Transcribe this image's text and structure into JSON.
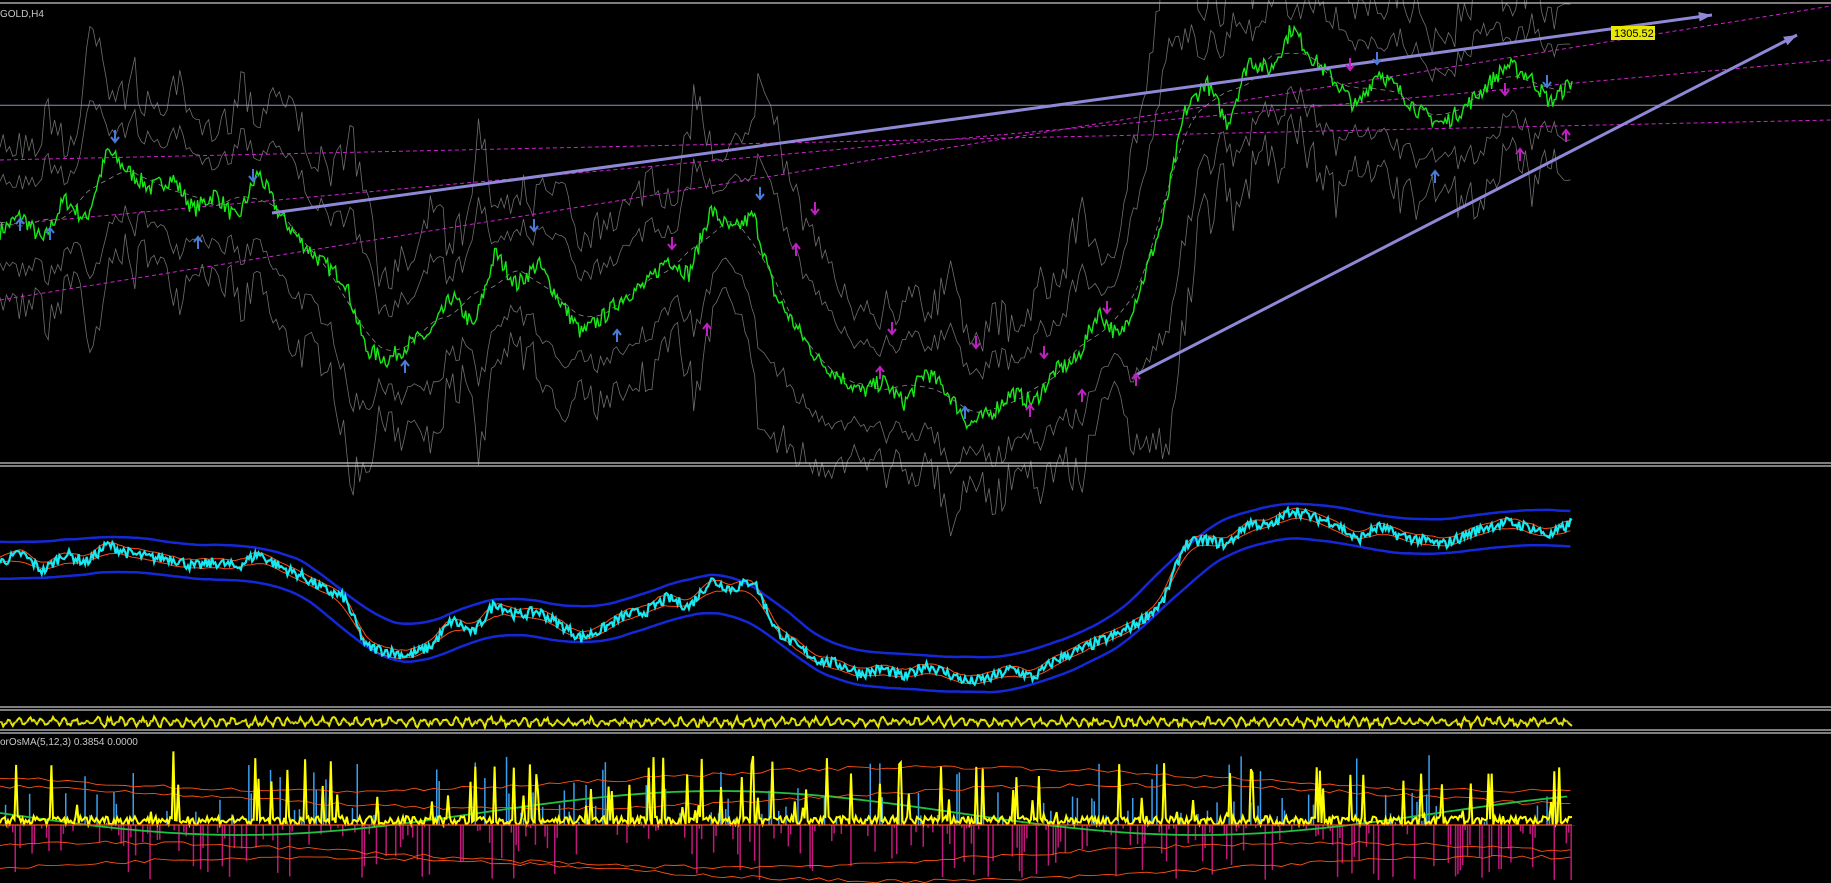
{
  "window": {
    "symbol_label": "GOLD,H4"
  },
  "colors": {
    "background": "#000000",
    "separator": "#c8c8c8",
    "price": "#18e818",
    "bands": "#8a8a8a",
    "trendline": "#8f88d6",
    "channel": "#d020d0",
    "hline": "#8a94b0",
    "arrow_blue": "#4a7bd8",
    "arrow_purple": "#c020c0",
    "price_tag_bg": "#e8e800",
    "ind1_main": "#18e8f0",
    "ind1_band": "#1428d8",
    "ind1_ma": "#ff4a10",
    "ind2_line": "#e8e800",
    "ind3_pos": "#3aa0f0",
    "ind3_neg": "#c0187a",
    "ind3_yellow": "#ffff00",
    "ind3_green": "#20c040",
    "ind3_orange": "#ff5010"
  },
  "price_tag": {
    "value": "1305.52"
  },
  "indicator_label": {
    "text": "orOsMA(5,12,3) 0.3854 0.0000"
  },
  "chart_data": [
    {
      "type": "line",
      "title": "GOLD,H4",
      "series": [
        {
          "name": "",
          "values": [
            1268,
            1271,
            1266,
            1274,
            1270,
            1283,
            1279,
            1276,
            1278,
            1272,
            1275,
            1270,
            1279,
            1271,
            1266,
            1262,
            1259,
            1246,
            1244,
            1247,
            1249,
            1256,
            1250,
            1264,
            1258,
            1262,
            1255,
            1249,
            1252,
            1256,
            1258,
            1263,
            1260,
            1272,
            1268,
            1271,
            1256,
            1250,
            1244,
            1241,
            1238,
            1240,
            1236,
            1242,
            1238,
            1232,
            1234,
            1238,
            1236,
            1242,
            1244,
            1253,
            1248,
            1258,
            1270,
            1290,
            1296,
            1288,
            1300,
            1298,
            1306,
            1300,
            1296,
            1291,
            1298,
            1294,
            1290,
            1288,
            1291,
            1295,
            1299,
            1297,
            1292,
            1296
          ]
        }
      ],
      "ylim": [
        1225,
        1310
      ],
      "annotations": [
        {
          "type": "horizontal",
          "value": 1291.5
        },
        {
          "type": "price-label",
          "value": "1305.52"
        }
      ]
    },
    {
      "type": "line",
      "series": [
        {
          "name": "",
          "values": [
            0.62,
            0.66,
            0.58,
            0.66,
            0.62,
            0.7,
            0.66,
            0.64,
            0.64,
            0.6,
            0.62,
            0.6,
            0.66,
            0.6,
            0.56,
            0.5,
            0.46,
            0.24,
            0.22,
            0.2,
            0.24,
            0.36,
            0.3,
            0.44,
            0.38,
            0.4,
            0.34,
            0.28,
            0.32,
            0.38,
            0.4,
            0.46,
            0.42,
            0.54,
            0.5,
            0.54,
            0.32,
            0.24,
            0.18,
            0.16,
            0.12,
            0.14,
            0.1,
            0.16,
            0.12,
            0.08,
            0.1,
            0.14,
            0.1,
            0.18,
            0.22,
            0.26,
            0.3,
            0.36,
            0.44,
            0.7,
            0.72,
            0.7,
            0.8,
            0.78,
            0.86,
            0.82,
            0.8,
            0.72,
            0.78,
            0.74,
            0.72,
            0.7,
            0.74,
            0.78,
            0.8,
            0.78,
            0.74,
            0.8
          ]
        }
      ]
    },
    {
      "type": "line",
      "series": [
        {
          "name": "",
          "values": [
            0.5,
            0.5
          ]
        }
      ]
    },
    {
      "type": "bar",
      "title": "orOsMA(5,12,3) 0.3854 0.0000",
      "series": [
        {
          "name": "",
          "values": [
            0.3854,
            0.0
          ]
        }
      ]
    }
  ]
}
